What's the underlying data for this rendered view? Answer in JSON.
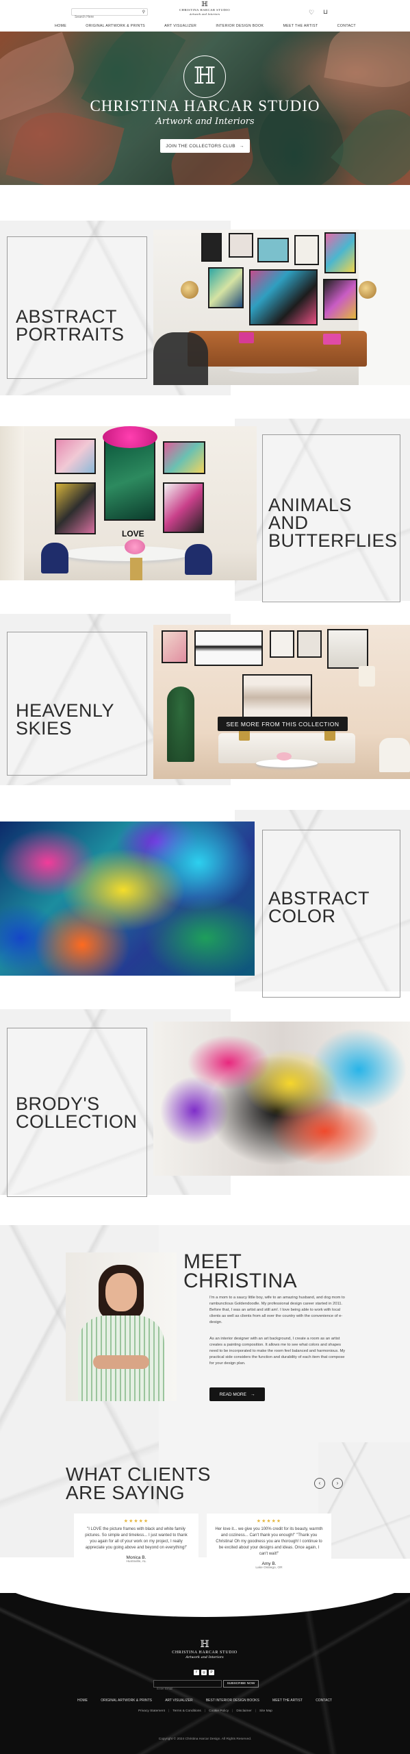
{
  "header": {
    "search_placeholder": "Search Here",
    "logo_name": "CHRISTINA HARCAR STUDIO",
    "logo_tagline": "Artwork and Interiors",
    "nav": [
      "HOME",
      "ORIGINAL ARTWORK & PRINTS",
      "ART VISUALIZER",
      "INTERIOR DESIGN BOOK",
      "MEET THE ARTIST",
      "CONTACT"
    ]
  },
  "hero": {
    "title": "CHRISTINA HARCAR STUDIO",
    "subtitle": "Artwork and Interiors",
    "button": "JOIN THE COLLECTORS CLUB",
    "button_arrow": "→"
  },
  "collections": [
    {
      "title": "ABSTRACT\nPORTRAITS"
    },
    {
      "title": "ANIMALS\nAND\nBUTTERFLIES"
    },
    {
      "title": "HEAVENLY\nSKIES"
    },
    {
      "title": "ABSTRACT\nCOLOR"
    },
    {
      "title": "BRODY'S\nCOLLECTION"
    }
  ],
  "see_more": "SEE MORE FROM THIS COLLECTION",
  "meet": {
    "title": "MEET\nCHRISTINA",
    "p1": "I'm a mom to a saucy little boy, wife to an amazing husband, and dog mom to rambunctious Goldendoodle. My professional design career started in 2011. Before that, I was an artist and still am!. I love being able to work with local clients as well as clients from all over the country with the convenience of e-design.",
    "p2": "As an interior designer with an art background, I create a room as an artist creates a painting composition. It allows me to see what colors and shapes need to be incorporated to make the room feel balanced and harmonious. My practical side considers the function and durability of each item that compose for your design plan.",
    "button": "READ MORE",
    "button_arrow": "→"
  },
  "testimonials": {
    "title": "WHAT CLIENTS\nARE SAYING",
    "prev": "‹",
    "next": "›",
    "cards": [
      {
        "stars": "★★★★★",
        "quote": "\"I LOVE the picture frames with black and white family pictures. So simple and timeless... I just wanted to thank you again for all of your work on my project, I really appreciate you going above and beyond on everything!\"",
        "name": "Monica B.",
        "location": "Huntsville, AL"
      },
      {
        "stars": "★★★★★",
        "quote": "Her love it... we give you 100% credit for its beauty, warmth and coziness... Can't thank you enough!\" \"Thank you Christina! Oh my goodness you are thorough! I continue to be excited about your designs and ideas. Once again, I can't wait!\"",
        "name": "Amy B.",
        "location": "Lake Oswego, OR"
      }
    ]
  },
  "footer": {
    "logo_name": "CHRISTINA HARCAR STUDIO",
    "logo_tagline": "Artwork and Interiors",
    "social": [
      "f",
      "◎",
      "P"
    ],
    "email_placeholder": "Enter Email",
    "subscribe": "SUBSCRIBE NOW",
    "nav": [
      "HOME",
      "ORIGINAL ARTWORK & PRINTS",
      "ART VISUALIZER",
      "BEST INTERIOR DESIGN BOOKS",
      "MEET THE ARTIST",
      "CONTACT"
    ],
    "legal": [
      "Privacy Statement",
      "Terms & Conditions",
      "Cookie Policy",
      "Disclaimer",
      "Site Map"
    ],
    "copyright": "Copyright © 2024 Christina Harcar Design. All Rights Reserved."
  },
  "colors": {
    "dark": "#141414",
    "accent_star": "#e4b53c",
    "marble": "#f1f1f1"
  }
}
